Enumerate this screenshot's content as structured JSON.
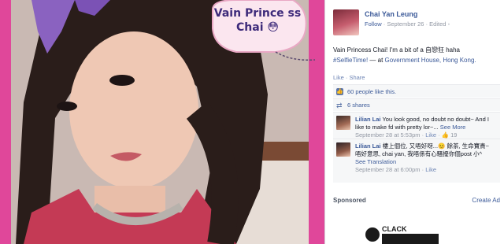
{
  "sticker": {
    "text": "Vain Prince ss Chai 😳"
  },
  "post": {
    "author": "Chai Yan Leung",
    "follow": "Follow",
    "date": "September 26",
    "edited": "Edited",
    "body": "Vain Princess Chai! I'm a bit of a 自戀狂 haha",
    "hashtag": "#SelfieTime!",
    "location_prefix": "— at",
    "location": "Government House, Hong Kong."
  },
  "actions": {
    "like": "Like",
    "share": "Share"
  },
  "stats": {
    "likes": "60 people like this.",
    "shares": "6 shares"
  },
  "comments": [
    {
      "name": "Lilian Lai",
      "text": "You look good, no doubt no doubt~ And I like to make fd with pretty lor~...",
      "see_more": "See More",
      "date": "September 28 at 5:53pm",
      "like": "Like",
      "likes_count": "19"
    },
    {
      "name": "Lilian Lai",
      "text": "樓上個位, 又唔好呀...😊 餘茶, 生命寶貴~",
      "text2": "唔好意思, chai yan, 我唔係有心騷擾你個post 小^",
      "see_translation": "See Translation",
      "date": "September 28 at 6:00pm",
      "like": "Like"
    }
  ],
  "sponsored": {
    "label": "Sponsored",
    "create_ad": "Create Ad",
    "ad_brand": "CLACK"
  },
  "colors": {
    "link": "#3b5998",
    "frame_pink": "#e0479a",
    "meta_gray": "#9197a3"
  }
}
